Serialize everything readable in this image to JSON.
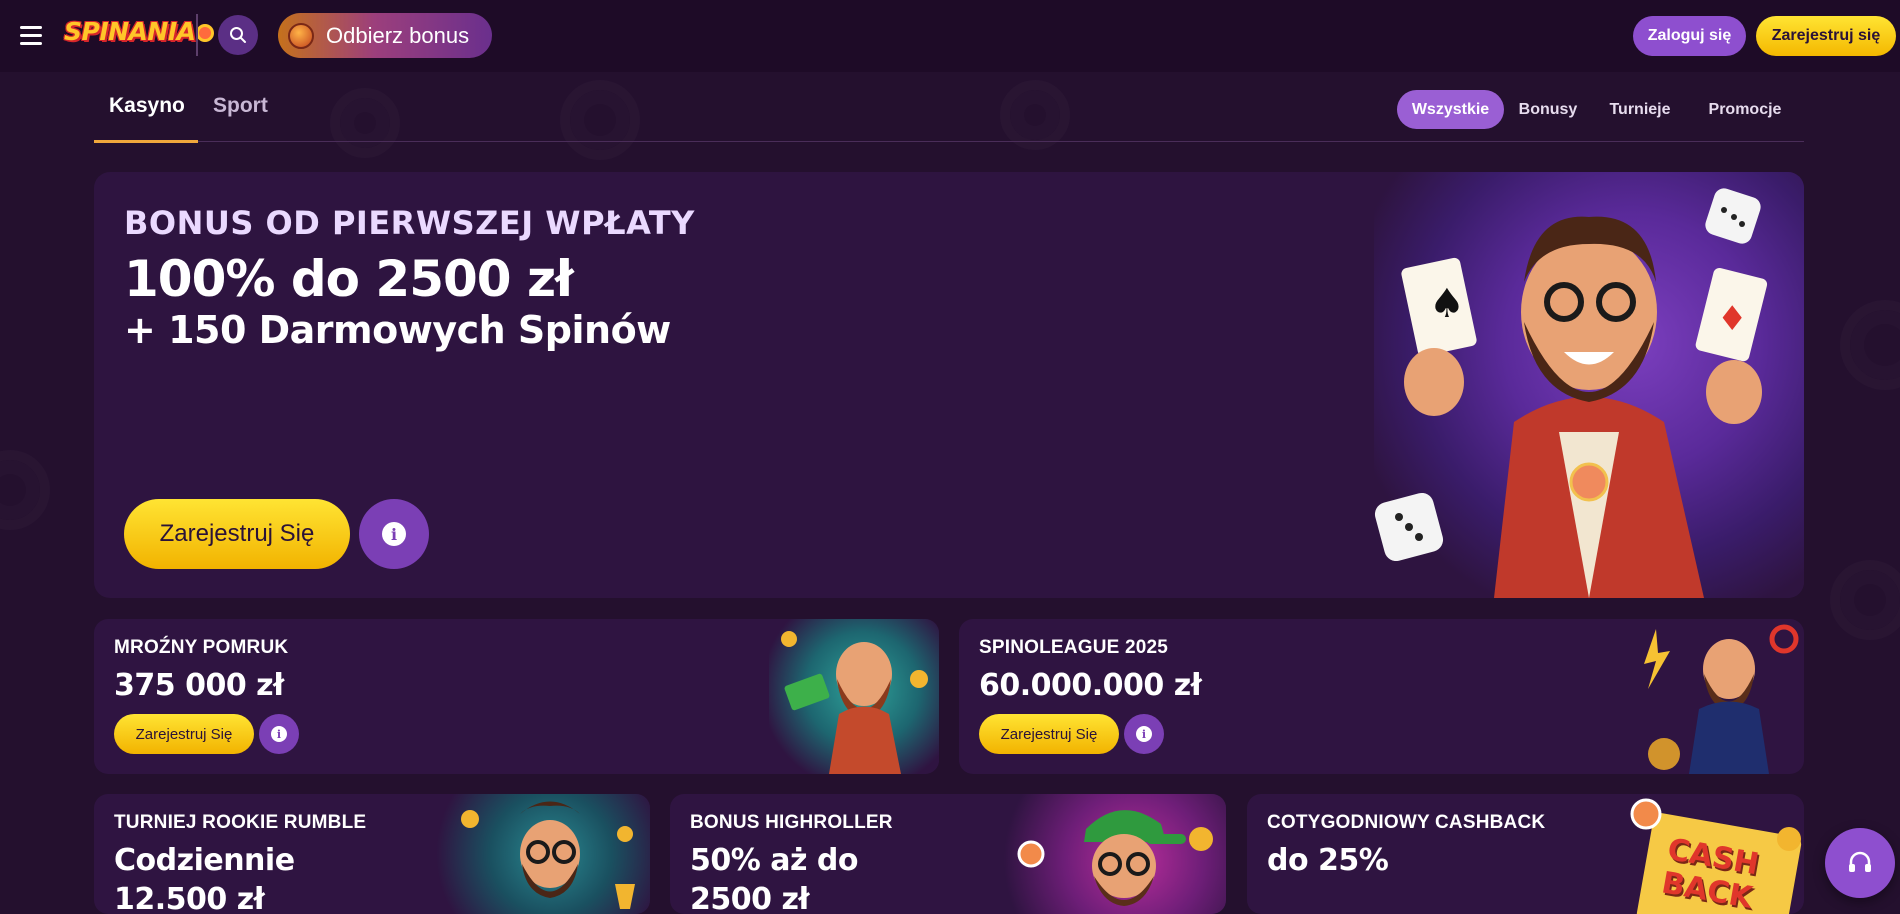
{
  "header": {
    "logo_text": "SPINANIA",
    "bonus_label": "Odbierz bonus",
    "login_label": "Zaloguj się",
    "register_label": "Zarejestruj się"
  },
  "tabs": {
    "main": [
      {
        "label": "Kasyno",
        "active": true
      },
      {
        "label": "Sport",
        "active": false
      }
    ],
    "filters": [
      {
        "label": "Wszystkie",
        "active": true
      },
      {
        "label": "Bonusy",
        "active": false
      },
      {
        "label": "Turnieje",
        "active": false
      },
      {
        "label": "Promocje",
        "active": false
      }
    ]
  },
  "hero": {
    "eyebrow": "BONUS OD PIERWSZEJ WPŁATY",
    "title": "100% do 2500 zł",
    "subtitle": "+ 150 Darmowych Spinów",
    "cta_label": "Zarejestruj Się",
    "info_glyph": "i"
  },
  "cards": [
    {
      "label": "MROŹNY POMRUK",
      "value": "375 000 zł",
      "cta_label": "Zarejestruj Się"
    },
    {
      "label": "SPINOLEAGUE 2025",
      "value": "60.000.000 zł",
      "cta_label": "Zarejestruj Się"
    },
    {
      "label": "TURNIEJ ROOKIE RUMBLE",
      "value": "Codziennie 12.500 zł"
    },
    {
      "label": "BONUS HIGHROLLER",
      "value": "50% aż do 2500 zł"
    },
    {
      "label": "COTYGODNIOWY CASHBACK",
      "value": "do 25%",
      "art_text": "CASH BACK"
    }
  ],
  "icons": {
    "menu": "hamburger-icon",
    "search": "search-icon",
    "bonus": "bonus-icon",
    "info": "info-icon",
    "support": "headset-icon"
  },
  "colors": {
    "background": "#24102e",
    "accent_yellow": "#ffd21f",
    "accent_purple": "#8e4fcf",
    "tab_underline": "#f0a73c"
  }
}
